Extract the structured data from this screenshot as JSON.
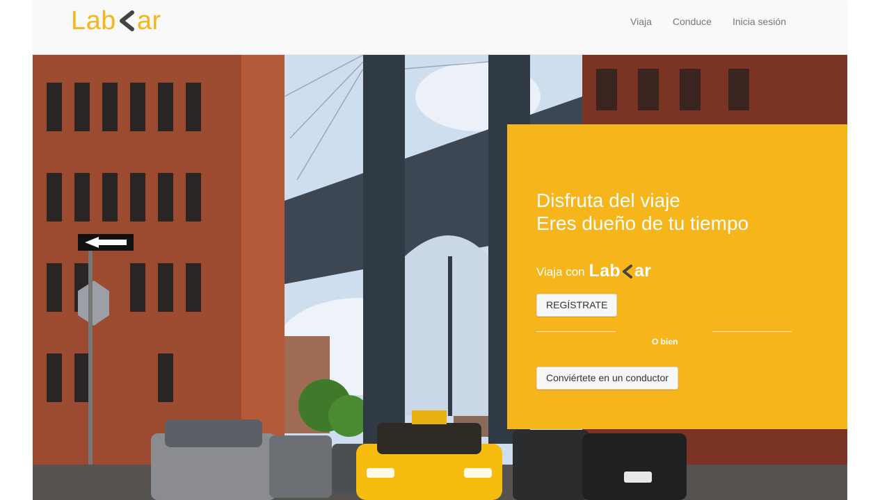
{
  "brand": {
    "left": "Lab",
    "right": "ar",
    "accent": "#f5b51b",
    "dark": "#444444"
  },
  "nav": {
    "items": [
      "Viaja",
      "Conduce",
      "Inicia sesión"
    ]
  },
  "hero": {
    "headline_line1": "Disfruta del viaje",
    "headline_line2": "Eres dueño de tu tiempo",
    "viaja_con": "Viaja con",
    "register_button": "REGÍSTRATE",
    "or_text": "O bien",
    "driver_button": "Conviértete en un conductor",
    "card_color": "#f5b51b"
  }
}
